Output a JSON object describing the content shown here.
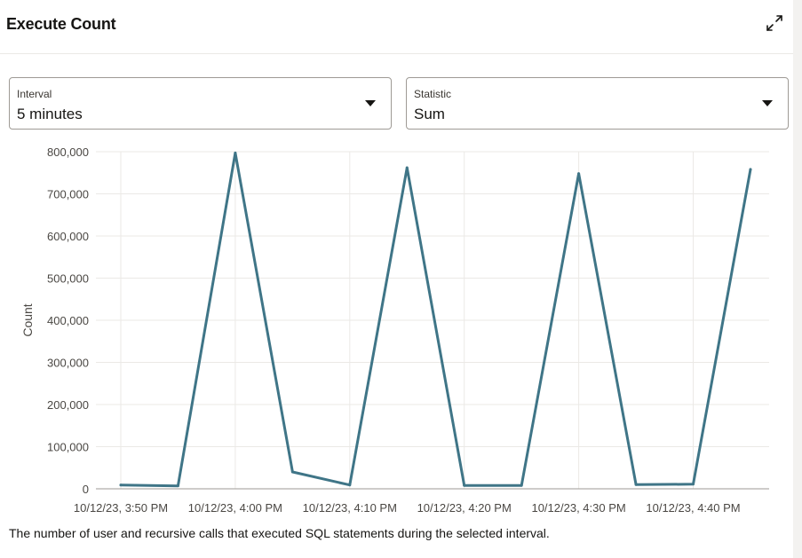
{
  "header": {
    "title": "Execute Count",
    "expand_icon": "expand-icon"
  },
  "controls": {
    "interval": {
      "label": "Interval",
      "value": "5 minutes"
    },
    "statistic": {
      "label": "Statistic",
      "value": "Sum"
    }
  },
  "chart_data": {
    "type": "line",
    "ylabel": "Count",
    "xlabel": "",
    "ylim": [
      0,
      800000
    ],
    "yticks": [
      0,
      100000,
      200000,
      300000,
      400000,
      500000,
      600000,
      700000,
      800000
    ],
    "ytick_labels": [
      "0",
      "100,000",
      "200,000",
      "300,000",
      "400,000",
      "500,000",
      "600,000",
      "700,000",
      "800,000"
    ],
    "xtick_labels": [
      "10/12/23, 3:50 PM",
      "10/12/23, 4:00 PM",
      "10/12/23, 4:10 PM",
      "10/12/23, 4:20 PM",
      "10/12/23, 4:30 PM",
      "10/12/23, 4:40 PM"
    ],
    "grid": true,
    "line_color": "#3f7587",
    "series": [
      {
        "x": [
          "10/12/23, 3:50 PM",
          "10/12/23, 3:55 PM",
          "10/12/23, 4:00 PM",
          "10/12/23, 4:05 PM",
          "10/12/23, 4:10 PM",
          "10/12/23, 4:15 PM",
          "10/12/23, 4:20 PM",
          "10/12/23, 4:25 PM",
          "10/12/23, 4:30 PM",
          "10/12/23, 4:35 PM",
          "10/12/23, 4:40 PM",
          "10/12/23, 4:45 PM"
        ],
        "values": [
          9000,
          7000,
          797000,
          40000,
          9000,
          762000,
          8000,
          8000,
          748000,
          10000,
          11000,
          758000
        ]
      }
    ]
  },
  "footer": {
    "description": "The number of user and recursive calls that executed SQL statements during the selected interval."
  }
}
